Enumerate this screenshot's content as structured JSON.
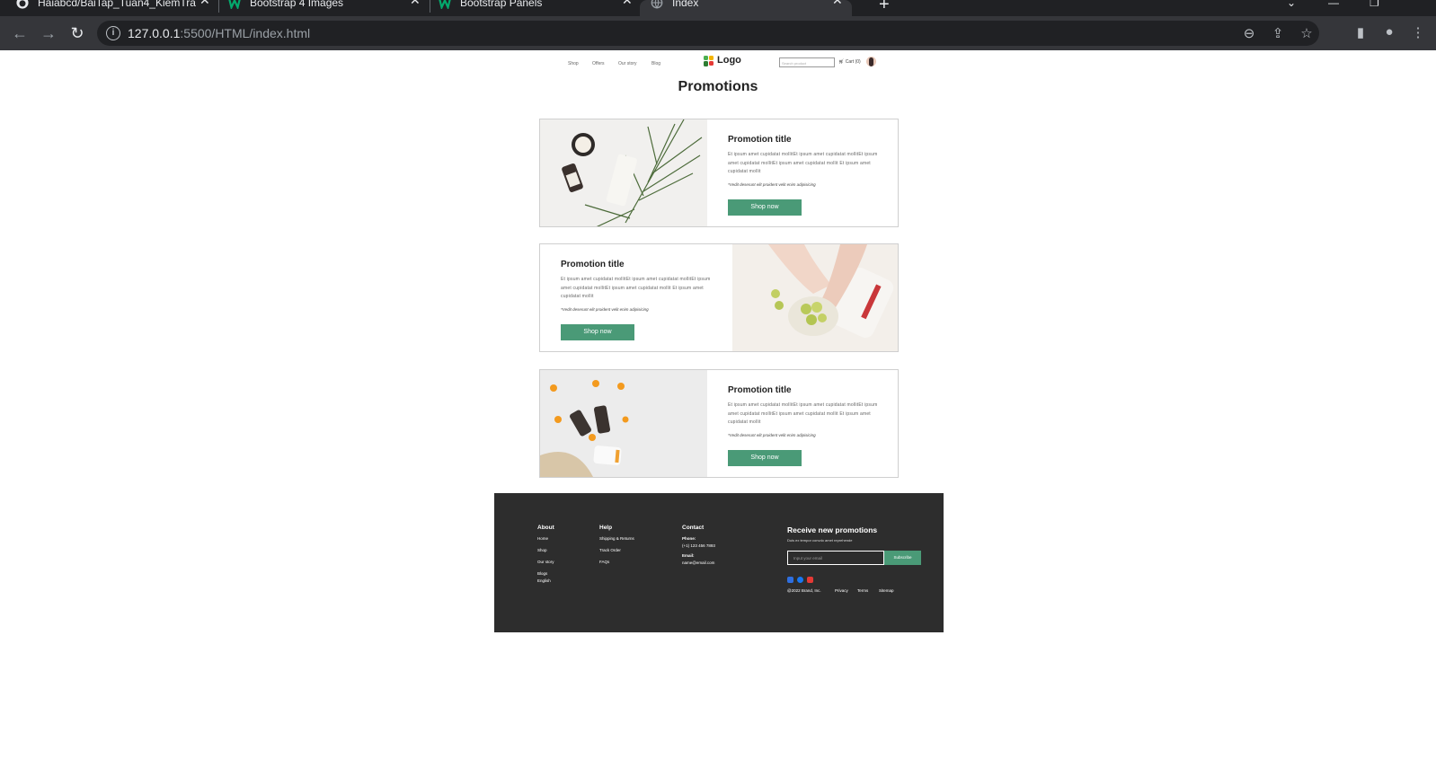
{
  "browser": {
    "tabs": [
      {
        "label": "Haiabcd/BaiTap_Tuan4_KiemTra",
        "icon": "github-icon"
      },
      {
        "label": "Bootstrap 4 Images",
        "icon": "w3schools-icon"
      },
      {
        "label": "Bootstrap Panels",
        "icon": "w3schools-icon"
      },
      {
        "label": "Index",
        "icon": "globe-icon"
      }
    ],
    "url_host": "127.0.0.1",
    "url_rest": ":5500/HTML/index.html"
  },
  "header": {
    "nav": [
      "Shop",
      "Offers",
      "Our story",
      "Blog"
    ],
    "logo": "Logo",
    "search_placeholder": "Search product",
    "cart": "Cart (0)"
  },
  "main": {
    "title": "Promotions",
    "cards": [
      {
        "title": "Promotion title",
        "description": "Et ipsum amet cupidatat mollitEt ipsum amet cupidatat mollitEt ipsum amet cupidatat mollitEt ipsum amet cupidatat mollit Et ipsum amet cupidatat mollit",
        "note": "*Vedit deserunt elit proident velit enim adipisicing",
        "button": "Shop now"
      },
      {
        "title": "Promotion title",
        "description": "Et ipsum amet cupidatat mollitEt ipsum amet cupidatat mollitEt ipsum amet cupidatat mollitEt ipsum amet cupidatat mollit Et ipsum amet cupidatat mollit",
        "note": "*Vedit deserunt elit proident velit enim adipisicing",
        "button": "Shop now"
      },
      {
        "title": "Promotion title",
        "description": "Et ipsum amet cupidatat mollitEt ipsum amet cupidatat mollitEt ipsum amet cupidatat mollitEt ipsum amet cupidatat mollit Et ipsum amet cupidatat mollit",
        "note": "*Vedit deserunt elit proident velit enim adipisicing",
        "button": "Shop now"
      }
    ]
  },
  "footer": {
    "about": {
      "heading": "About",
      "items": [
        "Home",
        "Shop",
        "Our story",
        "Blogs",
        "English"
      ]
    },
    "help": {
      "heading": "Help",
      "items": [
        "Shipping & Returns",
        "Track Order",
        "FAQs"
      ]
    },
    "contact": {
      "heading": "Contact",
      "phone_label": "Phone:",
      "phone": "(+1) 123 456 7893",
      "email_label": "Email:",
      "email": "name@email.com"
    },
    "promo": {
      "heading": "Receive new promotions",
      "subtext": "Duis ex tempor convdo amet reprehende",
      "input_placeholder": "Input your email",
      "button": "Subscribe"
    },
    "legal": [
      "@2022 Brand, Inc.",
      "Privacy",
      "Terms",
      "Sitemap"
    ]
  },
  "colors": {
    "accent": "#4a9a77",
    "footer_bg": "#2d2d2d"
  }
}
